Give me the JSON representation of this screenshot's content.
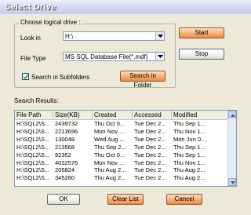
{
  "window": {
    "title": "Select Drive"
  },
  "group": {
    "label": "Choose logical drive :"
  },
  "look_in": {
    "label": "Look in",
    "value": "H:\\"
  },
  "file_type": {
    "label": "File Type",
    "value": "MS SQL Database File(*.mdf)"
  },
  "subfolders": {
    "label": "Search in Subfolders",
    "checked": true
  },
  "buttons": {
    "search_in_folder": "Search in Folder",
    "start": "Start",
    "stop": "Stop",
    "ok": "OK",
    "clear_list": "Clear List",
    "cancel": "Cancel"
  },
  "results": {
    "label": "Search Results:",
    "columns": [
      "File Path",
      "Size(KB)",
      "Created",
      "Accessed",
      "Modified"
    ],
    "rows": [
      [
        "H:\\SQL2\\S...",
        "2439732",
        "Thu Oct 0...",
        "Tue Dec 2...",
        "Thu Sep 1..."
      ],
      [
        "H:\\SQL2\\S...",
        "2213696",
        "Mon Nov ...",
        "Tue Dec 2...",
        "Thu Nov 1..."
      ],
      [
        "H:\\SQL2\\S...",
        "130048",
        "Wed Aug ...",
        "Tue Dec 2...",
        "Mon Jun 0..."
      ],
      [
        "H:\\SQL2\\S...",
        "213568",
        "Thu Sep 2...",
        "Tue Dec 2...",
        "Thu Sep 1..."
      ],
      [
        "H:\\SQL2\\S...",
        "92352",
        "Thu Oct 0...",
        "Tue Dec 2...",
        "Thu Sep 1..."
      ],
      [
        "H:\\SQL2\\S...",
        "4032576",
        "Mon Nov ...",
        "Tue Dec 2...",
        "Thu Nov 1..."
      ],
      [
        "H:\\SQL2\\S...",
        "205824",
        "Thu Aug 2...",
        "Tue Dec 2...",
        "Thu Aug 2..."
      ],
      [
        "H:\\SQL2\\S...",
        "345280",
        "Thu Aug 2...",
        "Tue Dec 2...",
        "Thu Aug 2..."
      ]
    ]
  },
  "colors": {
    "accent_orange": "#f7b27c",
    "title_gradient": "#c4c9e9",
    "border_blue": "#7f9db9"
  }
}
